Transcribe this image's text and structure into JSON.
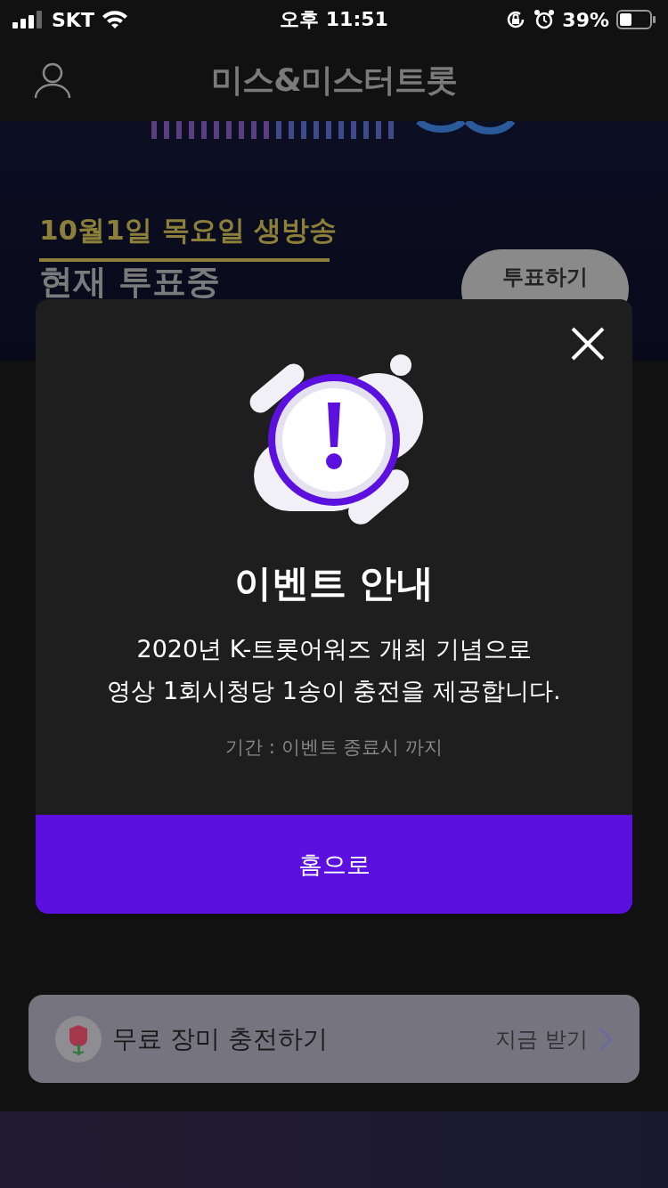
{
  "status_bar": {
    "carrier": "SKT",
    "time": "오후 11:51",
    "battery": "39%"
  },
  "header": {
    "logo": "미스&미스터트롯"
  },
  "banner": {
    "date": "10월1일 목요일 생방송",
    "title": "현재 투표중",
    "vote_button": "투표하기"
  },
  "promo": {
    "label": "무료 장미 충전하기",
    "action": "지금 받기"
  },
  "modal": {
    "title": "이벤트 안내",
    "message": "2020년 K-트롯어워즈 개최 기념으로\n영상 1회시청당 1송이 충전을 제공합니다.",
    "period": "기간 : 이벤트 종료시 까지",
    "button": "홈으로"
  }
}
